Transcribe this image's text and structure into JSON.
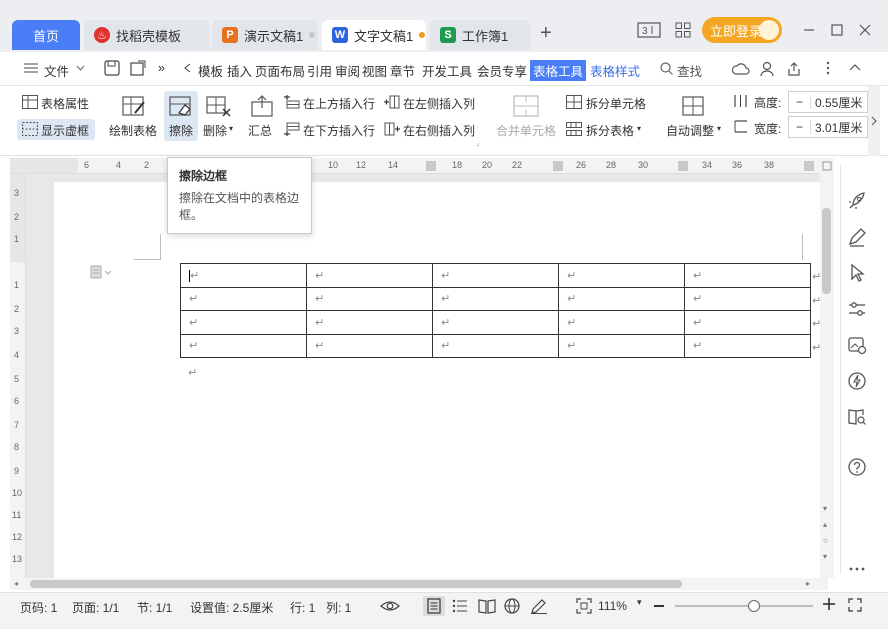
{
  "tabs": {
    "home": "首页",
    "templates": "找稻壳模板",
    "presentation": "演示文稿1",
    "document": "文字文稿1",
    "spreadsheet": "工作簿1",
    "new_tab": "+"
  },
  "header": {
    "view_badge": "3",
    "login_button": "立即登录"
  },
  "menu": {
    "file": "文件",
    "more": "»",
    "items": [
      "模板",
      "插入",
      "页面布局",
      "引用",
      "审阅",
      "视图",
      "章节",
      "开发工具",
      "会员专享"
    ],
    "table_tools": "表格工具",
    "table_style": "表格样式",
    "search": "查找"
  },
  "ribbon": {
    "table_properties": "表格属性",
    "show_gridlines": "显示虚框",
    "draw_table": "绘制表格",
    "erase": "擦除",
    "delete": "删除",
    "summary": "汇总",
    "insert_row_above": "在上方插入行",
    "insert_row_below": "在下方插入行",
    "insert_col_left": "在左侧插入列",
    "insert_col_right": "在右侧插入列",
    "merge_cells": "合并单元格",
    "split_cells": "拆分单元格",
    "split_table": "拆分表格",
    "auto_fit": "自动调整",
    "height_label": "高度:",
    "height_value": "0.55厘米",
    "width_label": "宽度:",
    "width_value": "3.01厘米",
    "minus": "−"
  },
  "tooltip": {
    "title": "擦除边框",
    "description": "擦除在文档中的表格边框。"
  },
  "ruler": {
    "horizontal": [
      "6",
      "4",
      "2",
      "10",
      "12",
      "14",
      "18",
      "20",
      "22",
      "26",
      "28",
      "30",
      "34",
      "36",
      "38"
    ],
    "vertical": [
      "3",
      "2",
      "1",
      "1",
      "2",
      "3",
      "4",
      "5",
      "6",
      "7",
      "8",
      "9",
      "10",
      "11",
      "12",
      "13"
    ]
  },
  "document": {
    "paragraph_mark": "↵",
    "table": {
      "rows": 4,
      "cols": 5
    }
  },
  "status": {
    "page": "页码: 1",
    "pages": "页面: 1/1",
    "section": "节: 1/1",
    "setting": "设置值: 2.5厘米",
    "row": "行: 1",
    "col": "列: 1",
    "zoom": "111%",
    "zoom_level": 0.57
  },
  "colors": {
    "accent": "#4a7ef6",
    "login": "#f5a623",
    "ppt": "#e8711f",
    "doc": "#2d65e0",
    "xls": "#1e9b50",
    "templates": "#e0312f",
    "unsaved_dot": "#f39a1e"
  }
}
